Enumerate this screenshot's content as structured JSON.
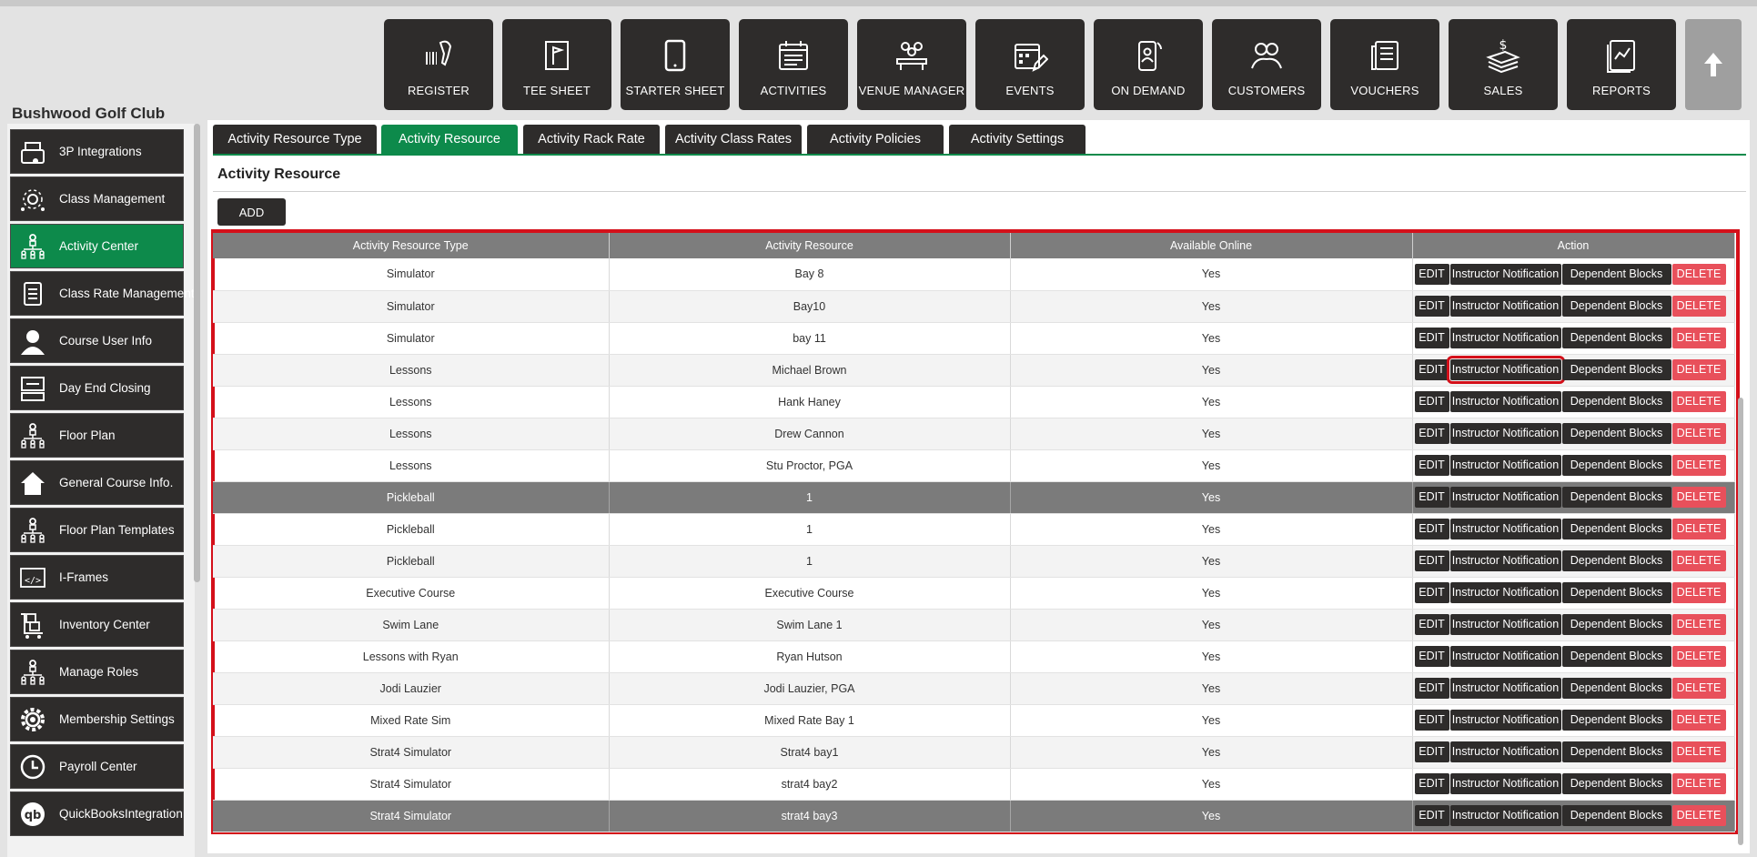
{
  "header": {
    "club_name": "Bushwood Golf Club",
    "nav": [
      {
        "label": "REGISTER",
        "icon": "barcode-scanner-icon"
      },
      {
        "label": "TEE SHEET",
        "icon": "flag-sheet-icon"
      },
      {
        "label": "STARTER SHEET",
        "icon": "tablet-icon"
      },
      {
        "label": "ACTIVITIES",
        "icon": "calendar-list-icon"
      },
      {
        "label": "VENUE MANAGER",
        "icon": "meeting-table-icon"
      },
      {
        "label": "EVENTS",
        "icon": "calendar-pencil-icon"
      },
      {
        "label": "ON DEMAND",
        "icon": "mobile-user-icon"
      },
      {
        "label": "CUSTOMERS",
        "icon": "users-group-icon"
      },
      {
        "label": "VOUCHERS",
        "icon": "document-stack-icon"
      },
      {
        "label": "SALES",
        "icon": "money-stack-icon"
      },
      {
        "label": "REPORTS",
        "icon": "report-chart-icon"
      }
    ],
    "scroll_top_icon": "arrow-up-icon"
  },
  "sidebar": {
    "items": [
      {
        "label": "3P Integrations",
        "icon": "cash-register-icon"
      },
      {
        "label": "Class Management",
        "icon": "settings-people-icon"
      },
      {
        "label": "Activity  Center",
        "icon": "org-chart-icon",
        "active": true
      },
      {
        "label": "Class Rate Management",
        "icon": "checklist-icon"
      },
      {
        "label": "Course User Info",
        "icon": "user-icon"
      },
      {
        "label": "Day End Closing",
        "icon": "register-drawer-icon"
      },
      {
        "label": "Floor Plan",
        "icon": "org-chart-icon"
      },
      {
        "label": "General Course Info.",
        "icon": "home-icon"
      },
      {
        "label": "Floor Plan Templates",
        "icon": "org-chart-icon"
      },
      {
        "label": "I-Frames",
        "icon": "code-icon"
      },
      {
        "label": "Inventory Center",
        "icon": "cart-boxes-icon"
      },
      {
        "label": "Manage Roles",
        "icon": "org-chart-icon"
      },
      {
        "label": "Membership Settings",
        "icon": "gear-icon"
      },
      {
        "label": "Payroll Center",
        "icon": "clock-icon"
      },
      {
        "label": "QuickBooksIntegration",
        "icon": "quickbooks-icon"
      }
    ]
  },
  "tabs": [
    {
      "label": "Activity Resource Type"
    },
    {
      "label": "Activity Resource",
      "active": true
    },
    {
      "label": "Activity Rack Rate"
    },
    {
      "label": "Activity Class Rates"
    },
    {
      "label": "Activity Policies"
    },
    {
      "label": "Activity Settings"
    }
  ],
  "section": {
    "title": "Activity Resource",
    "add_label": "ADD"
  },
  "colors": {
    "accent_green": "#0d8a4b",
    "dark": "#2e2c2b",
    "delete_red": "#e8505b",
    "highlight_red": "#d4101a"
  },
  "table": {
    "headers": [
      "Activity Resource Type",
      "Activity Resource",
      "Available Online",
      "Action"
    ],
    "action_labels": {
      "edit": "EDIT",
      "notify": "Instructor Notification",
      "blocks": "Dependent Blocks",
      "delete": "DELETE"
    },
    "rows": [
      {
        "type": "Simulator",
        "resource": "Bay 8",
        "online": "Yes"
      },
      {
        "type": "Simulator",
        "resource": "Bay10",
        "online": "Yes"
      },
      {
        "type": "Simulator",
        "resource": "bay 11",
        "online": "Yes"
      },
      {
        "type": "Lessons",
        "resource": "Michael Brown",
        "online": "Yes",
        "highlight_notify": true
      },
      {
        "type": "Lessons",
        "resource": "Hank Haney",
        "online": "Yes"
      },
      {
        "type": "Lessons",
        "resource": "Drew Cannon",
        "online": "Yes"
      },
      {
        "type": "Lessons",
        "resource": "Stu Proctor, PGA",
        "online": "Yes"
      },
      {
        "type": "Pickleball",
        "resource": "1",
        "online": "Yes",
        "selected": true
      },
      {
        "type": "Pickleball",
        "resource": "1",
        "online": "Yes"
      },
      {
        "type": "Pickleball",
        "resource": "1",
        "online": "Yes"
      },
      {
        "type": "Executive Course",
        "resource": "Executive Course",
        "online": "Yes"
      },
      {
        "type": "Swim Lane",
        "resource": "Swim Lane 1",
        "online": "Yes"
      },
      {
        "type": "Lessons with Ryan",
        "resource": "Ryan Hutson",
        "online": "Yes"
      },
      {
        "type": "Jodi Lauzier",
        "resource": "Jodi Lauzier, PGA",
        "online": "Yes"
      },
      {
        "type": "Mixed Rate Sim",
        "resource": "Mixed Rate Bay 1",
        "online": "Yes"
      },
      {
        "type": "Strat4 Simulator",
        "resource": "Strat4 bay1",
        "online": "Yes"
      },
      {
        "type": "Strat4 Simulator",
        "resource": "strat4 bay2",
        "online": "Yes"
      },
      {
        "type": "Strat4 Simulator",
        "resource": "strat4 bay3",
        "online": "Yes",
        "selected": true
      }
    ]
  }
}
